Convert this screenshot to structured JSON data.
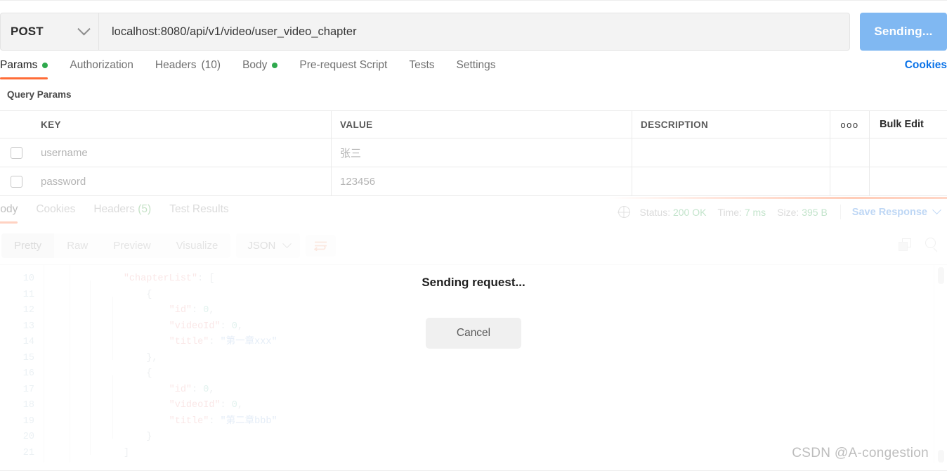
{
  "request": {
    "method": "POST",
    "url": "localhost:8080/api/v1/video/user_video_chapter",
    "send_label": "Sending...",
    "send_color": "#80b8f2",
    "tabs": [
      {
        "label": "Params",
        "dot": true,
        "active": true
      },
      {
        "label": "Authorization",
        "dot": false,
        "active": false
      },
      {
        "label": "Headers",
        "count": "(10)",
        "dot": false,
        "active": false
      },
      {
        "label": "Body",
        "dot": true,
        "active": false
      },
      {
        "label": "Pre-request Script",
        "dot": false,
        "active": false
      },
      {
        "label": "Tests",
        "dot": false,
        "active": false
      },
      {
        "label": "Settings",
        "dot": false,
        "active": false
      }
    ],
    "cookies_link": "Cookies",
    "accent_color": "#ff6c37"
  },
  "params": {
    "section_title": "Query Params",
    "columns": [
      "KEY",
      "VALUE",
      "DESCRIPTION"
    ],
    "options_icon": "ooo",
    "bulk_edit": "Bulk Edit",
    "rows": [
      {
        "checked": false,
        "key": "username",
        "value": "张三",
        "description": ""
      },
      {
        "checked": false,
        "key": "password",
        "value": "123456",
        "description": ""
      }
    ]
  },
  "response": {
    "tabs": [
      {
        "label": "Body",
        "active": true
      },
      {
        "label": "Cookies",
        "active": false
      },
      {
        "label": "Headers",
        "count": "(5)",
        "active": false
      },
      {
        "label": "Test Results",
        "active": false
      }
    ],
    "status_label": "Status:",
    "status_value": "200 OK",
    "time_label": "Time:",
    "time_value": "7 ms",
    "size_label": "Size:",
    "size_value": "395 B",
    "save_response": "Save Response",
    "status_color": "#3aa856",
    "formats": [
      {
        "label": "Pretty",
        "active": true
      },
      {
        "label": "Raw",
        "active": false
      },
      {
        "label": "Preview",
        "active": false
      },
      {
        "label": "Visualize",
        "active": false
      }
    ],
    "content_type": "JSON",
    "code_lines": [
      {
        "n": "10",
        "indent": 2,
        "tokens": [
          {
            "t": "key",
            "v": "\"chapterList\""
          },
          {
            "t": "pun",
            "v": ": ["
          }
        ]
      },
      {
        "n": "11",
        "indent": 3,
        "tokens": [
          {
            "t": "pun",
            "v": "{"
          }
        ]
      },
      {
        "n": "12",
        "indent": 4,
        "tokens": [
          {
            "t": "key",
            "v": "\"id\""
          },
          {
            "t": "pun",
            "v": ": "
          },
          {
            "t": "num",
            "v": "0"
          },
          {
            "t": "pun",
            "v": ","
          }
        ]
      },
      {
        "n": "13",
        "indent": 4,
        "tokens": [
          {
            "t": "key",
            "v": "\"videoId\""
          },
          {
            "t": "pun",
            "v": ": "
          },
          {
            "t": "num",
            "v": "0"
          },
          {
            "t": "pun",
            "v": ","
          }
        ]
      },
      {
        "n": "14",
        "indent": 4,
        "tokens": [
          {
            "t": "key",
            "v": "\"title\""
          },
          {
            "t": "pun",
            "v": ": "
          },
          {
            "t": "str",
            "v": "\"第一章xxx\""
          }
        ]
      },
      {
        "n": "15",
        "indent": 3,
        "tokens": [
          {
            "t": "pun",
            "v": "},"
          }
        ]
      },
      {
        "n": "16",
        "indent": 3,
        "tokens": [
          {
            "t": "pun",
            "v": "{"
          }
        ]
      },
      {
        "n": "17",
        "indent": 4,
        "tokens": [
          {
            "t": "key",
            "v": "\"id\""
          },
          {
            "t": "pun",
            "v": ": "
          },
          {
            "t": "num",
            "v": "0"
          },
          {
            "t": "pun",
            "v": ","
          }
        ]
      },
      {
        "n": "18",
        "indent": 4,
        "tokens": [
          {
            "t": "key",
            "v": "\"videoId\""
          },
          {
            "t": "pun",
            "v": ": "
          },
          {
            "t": "num",
            "v": "0"
          },
          {
            "t": "pun",
            "v": ","
          }
        ]
      },
      {
        "n": "19",
        "indent": 4,
        "tokens": [
          {
            "t": "key",
            "v": "\"title\""
          },
          {
            "t": "pun",
            "v": ": "
          },
          {
            "t": "str",
            "v": "\"第二章bbb\""
          }
        ]
      },
      {
        "n": "20",
        "indent": 3,
        "tokens": [
          {
            "t": "pun",
            "v": "}"
          }
        ]
      },
      {
        "n": "21",
        "indent": 2,
        "tokens": [
          {
            "t": "pun",
            "v": "]"
          }
        ]
      }
    ]
  },
  "overlay": {
    "title": "Sending request...",
    "cancel": "Cancel"
  },
  "watermark": "CSDN @A-congestion"
}
